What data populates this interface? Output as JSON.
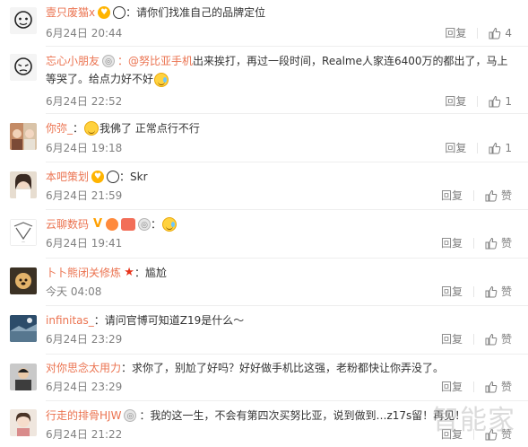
{
  "comments": [
    {
      "user": "壹只废猫x",
      "text": "：请你们找准自己的品牌定位",
      "date": "6月24日 20:44",
      "reply": "回复",
      "likes": "4"
    },
    {
      "user": "忘心小朋友",
      "mention": "：@努比亚手机",
      "text_line1": " 出来挨打，再过一段时间，Realme人家连6400万的都出了，马上",
      "text_line2": "等哭了。给点力好不好",
      "date": "6月24日 22:52",
      "reply": "回复",
      "likes": "1"
    },
    {
      "user": "你弥_",
      "text": "我佛了 正常点行不行",
      "date": "6月24日 19:18",
      "reply": "回复",
      "likes": "1"
    },
    {
      "user": "本吧策划",
      "text": "：Skr",
      "date": "6月24日 21:59",
      "reply": "回复",
      "likes": "赞"
    },
    {
      "user": "云聊数码",
      "text": "",
      "date": "6月24日 19:41",
      "reply": "回复",
      "likes": "赞"
    },
    {
      "user": "卜卜熊闭关修炼",
      "text": "：尴尬",
      "date": "今天 04:08",
      "reply": "回复",
      "likes": "赞"
    },
    {
      "user": "infinitas_",
      "text": "：请问官博可知道Z19是什么～",
      "date": "6月24日 23:29",
      "reply": "回复",
      "likes": "赞"
    },
    {
      "user": "对你思念太用力",
      "text": "：求你了，别尬了好吗？好好做手机比这强，老粉都快让你弄没了。",
      "date": "6月24日 23:29",
      "reply": "回复",
      "likes": "赞"
    },
    {
      "user": "行走的排骨HJW",
      "text": "：我的这一生，不会有第四次买努比亚，说到做到…z17s留！再见！",
      "date": "6月24日 21:22",
      "reply": "回复",
      "likes": "赞"
    }
  ],
  "watermark": "智能家",
  "colors": {
    "username": "#eb7350",
    "meta": "#808080",
    "text": "#333333"
  },
  "icons": {
    "like": "thumbs-up-icon",
    "medal": "medal-icon",
    "panda": "panda-icon",
    "vip": "vip-badge-icon"
  }
}
